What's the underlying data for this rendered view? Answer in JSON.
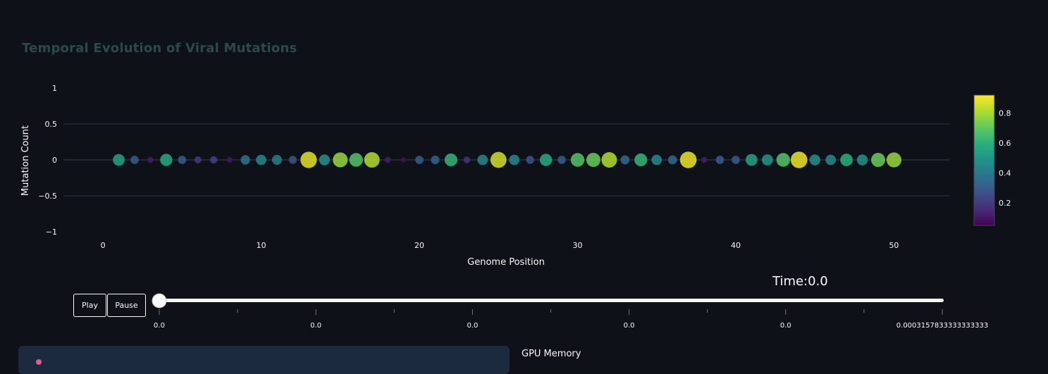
{
  "chart_data": {
    "type": "scatter",
    "title": "Temporal Evolution of Viral Mutations",
    "xlabel": "Genome Position",
    "ylabel": "Mutation Count",
    "xlim": [
      -2.5,
      53.5
    ],
    "ylim": [
      -1,
      1
    ],
    "xticks": [
      0,
      10,
      20,
      30,
      40,
      50
    ],
    "yticks": [
      1,
      0.5,
      0,
      -0.5,
      -1
    ],
    "ytick_labels": [
      "1",
      "0.5",
      "0",
      "−0.5",
      "−1"
    ],
    "grid": true,
    "x": [
      1,
      2,
      3,
      4,
      5,
      6,
      7,
      8,
      9,
      10,
      11,
      12,
      13,
      14,
      15,
      16,
      17,
      18,
      19,
      20,
      21,
      22,
      23,
      24,
      25,
      26,
      27,
      28,
      29,
      30,
      31,
      32,
      33,
      34,
      35,
      36,
      37,
      38,
      39,
      40,
      41,
      42,
      43,
      44,
      45,
      46,
      47,
      48,
      49,
      50
    ],
    "y": [
      0,
      0,
      0,
      0,
      0,
      0,
      0,
      0,
      0,
      0,
      0,
      0,
      0,
      0,
      0,
      0,
      0,
      0,
      0,
      0,
      0,
      0,
      0,
      0,
      0,
      0,
      0,
      0,
      0,
      0,
      0,
      0,
      0,
      0,
      0,
      0,
      0,
      0,
      0,
      0,
      0,
      0,
      0,
      0,
      0,
      0,
      0,
      0,
      0,
      0,
      0,
      0,
      0,
      0,
      0,
      0,
      0,
      0,
      0,
      0
    ],
    "color_values": [
      0.55,
      0.3,
      0.12,
      0.58,
      0.3,
      0.2,
      0.22,
      0.1,
      0.38,
      0.45,
      0.42,
      0.28,
      0.88,
      0.48,
      0.78,
      0.68,
      0.82,
      0.12,
      0.08,
      0.3,
      0.32,
      0.62,
      0.18,
      0.45,
      0.86,
      0.45,
      0.28,
      0.58,
      0.3,
      0.68,
      0.72,
      0.82,
      0.35,
      0.62,
      0.45,
      0.35,
      0.9,
      0.12,
      0.3,
      0.3,
      0.55,
      0.5,
      0.68,
      0.9,
      0.48,
      0.45,
      0.6,
      0.48,
      0.72,
      0.78
    ],
    "colorbar": {
      "range": [
        0.05,
        0.92
      ],
      "ticks": [
        0.2,
        0.4,
        0.6,
        0.8
      ],
      "tick_labels": [
        "0.2",
        "0.4",
        "0.6",
        "0.8"
      ]
    }
  },
  "controls": {
    "play_label": "Play",
    "pause_label": "Pause",
    "time_label": "Time:0.0",
    "slider_ticks": [
      "0.0",
      "0.0",
      "0.0",
      "0.0",
      "0.0",
      "0.0003157833333333333"
    ],
    "slider_value": 0
  },
  "footer": {
    "gpu_label": "GPU Memory"
  },
  "colors": {
    "background": "#0e1117",
    "grid": "#2f333d",
    "title": "#2a4a4c",
    "card": "#1b2a3f"
  }
}
